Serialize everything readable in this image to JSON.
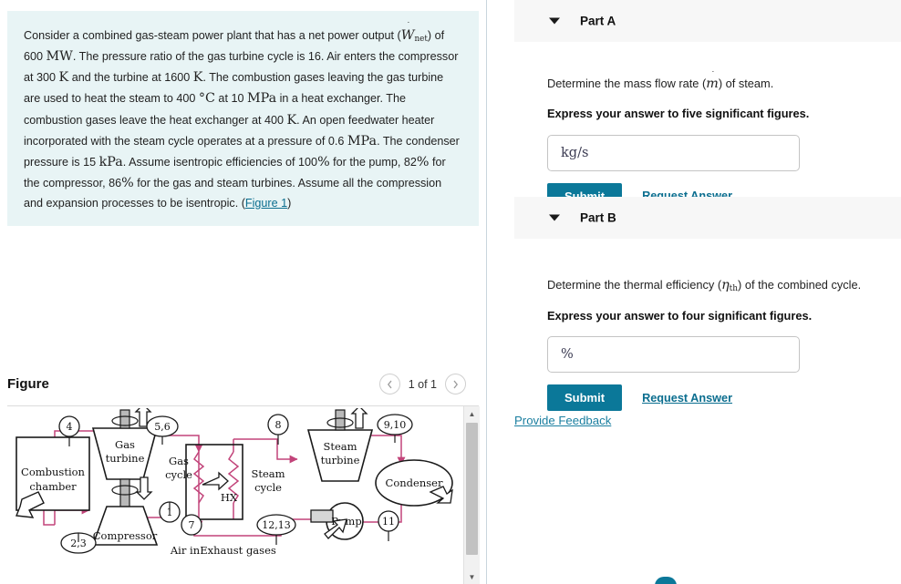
{
  "problem": {
    "seg1": "Consider a combined gas-steam power plant that has a net power output (",
    "w_symbol": "W",
    "w_sub": "net",
    "seg2": ") of 600 ",
    "u_mw": "MW",
    "seg3": ". The pressure ratio of the gas turbine cycle is 16. Air enters the compressor at 300 ",
    "u_k1": "K",
    "seg4": " and the turbine at 1600 ",
    "u_k2": "K",
    "seg5": ". The combustion gases leaving the gas turbine are used to heat the steam to 400 ",
    "u_degc": "°C",
    "seg6": " at 10 ",
    "u_mpa1": "MPa",
    "seg7": " in a heat exchanger. The combustion gases leave the heat exchanger at 400 ",
    "u_k3": "K",
    "seg8": ". An open feedwater heater incorporated with the steam cycle operates at a pressure of 0.6 ",
    "u_mpa2": "MPa",
    "seg9": ". The condenser pressure is 15 ",
    "u_kpa": "kPa",
    "seg10": ". Assume isentropic efficiencies of 100",
    "u_pct1": "%",
    "seg11": " for the pump, 82",
    "u_pct2": "%",
    "seg12": " for the compressor, 86",
    "u_pct3": "%",
    "seg13": " for the gas and steam turbines. Assume all the compression and expansion processes to be isentropic. (",
    "figure_link": "Figure 1",
    "seg14": ")"
  },
  "figure": {
    "title": "Figure",
    "pager_prev_icon": "chevron-left-icon",
    "pager_next_icon": "chevron-right-icon",
    "pager_label": "1 of 1",
    "scrollbar_up_icon": "triangle-up-icon",
    "scrollbar_down_icon": "triangle-down-icon",
    "diagram": {
      "labels": {
        "combustion_chamber": "Combustion\nchamber",
        "combustion_chamber_l1": "Combustion",
        "combustion_chamber_l2": "chamber",
        "gas_turbine_l1": "Gas",
        "gas_turbine_l2": "turbine",
        "compressor": "Compressor",
        "gas_cycle_l1": "Gas",
        "gas_cycle_l2": "cycle",
        "air_in": "Air in",
        "exhaust_gases": "Exhaust gases",
        "hx": "HX",
        "steam_cycle_l1": "Steam",
        "steam_cycle_l2": "cycle",
        "steam_turbine_l1": "Steam",
        "steam_turbine_l2": "turbine",
        "condenser": "Condenser",
        "pump": "Pump"
      },
      "state_points": [
        "4",
        "5,6",
        "8",
        "9,10",
        "1",
        "7",
        "12,13",
        "11",
        "2,3"
      ],
      "line_color": "#c2447a",
      "outline_color": "#1a1a1a"
    }
  },
  "parts": [
    {
      "id": "part-a",
      "title": "Part A",
      "caret_icon": "caret-down-icon",
      "question_pre": "Determine the mass flow rate (",
      "question_symbol": "m",
      "question_post": ") of steam.",
      "instruction": "Express your answer to five significant figures.",
      "input_value": "",
      "input_unit": "kg/s",
      "submit_label": "Submit",
      "request_label": "Request Answer"
    },
    {
      "id": "part-b",
      "title": "Part B",
      "caret_icon": "caret-down-icon",
      "question_pre": "Determine the thermal efficiency (",
      "question_symbol": "η",
      "question_symbol_sub": "th",
      "question_post": ") of the combined cycle.",
      "instruction": "Express your answer to four significant figures.",
      "input_value": "",
      "input_unit": "%",
      "submit_label": "Submit",
      "request_label": "Request Answer"
    }
  ],
  "footer": {
    "feedback_label": "Provide Feedback"
  },
  "colors": {
    "problem_bg": "#e8f4f5",
    "accent_teal": "#0b7899",
    "link_teal": "#0b6e8f",
    "band_gray": "#f7f7f7",
    "diagram_pink": "#c2447a"
  }
}
